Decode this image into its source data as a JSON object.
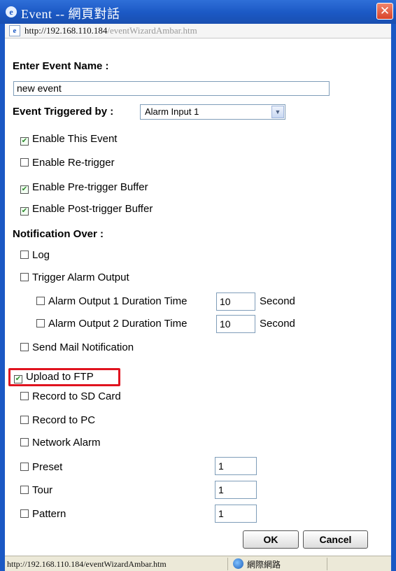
{
  "window": {
    "title": "Event -- 網頁對話",
    "close_glyph": "✕",
    "address": {
      "host": "http://192.168.110.184",
      "path": "/eventWizardAmbar.htm"
    }
  },
  "form": {
    "event_name_label": "Enter Event Name :",
    "event_name_value": "new event",
    "triggered_by_label": "Event Triggered by :",
    "triggered_by_value": "Alarm Input 1",
    "options": [
      {
        "label": "Enable This Event",
        "checked": true
      },
      {
        "label": "Enable Re-trigger",
        "checked": false
      },
      {
        "label": "Enable Pre-trigger Buffer",
        "checked": true
      },
      {
        "label": "Enable Post-trigger Buffer",
        "checked": true
      }
    ],
    "notification_label": "Notification Over :",
    "notifications": {
      "log": {
        "label": "Log",
        "checked": false
      },
      "trigger_alarm_output": {
        "label": "Trigger Alarm Output",
        "checked": false
      },
      "alarm_output_1": {
        "label": "Alarm Output 1 Duration Time",
        "checked": false,
        "value": "10",
        "unit": "Second"
      },
      "alarm_output_2": {
        "label": "Alarm Output 2 Duration Time",
        "checked": false,
        "value": "10",
        "unit": "Second"
      },
      "send_mail": {
        "label": "Send Mail Notification",
        "checked": false
      },
      "upload_ftp": {
        "label": "Upload to FTP",
        "checked": true
      },
      "record_sd": {
        "label": "Record to SD Card",
        "checked": false
      },
      "record_pc": {
        "label": "Record to PC",
        "checked": false
      },
      "network_alarm": {
        "label": "Network Alarm",
        "checked": false
      },
      "preset": {
        "label": "Preset",
        "checked": false,
        "value": "1"
      },
      "tour": {
        "label": "Tour",
        "checked": false,
        "value": "1"
      },
      "pattern": {
        "label": "Pattern",
        "checked": false,
        "value": "1"
      }
    },
    "ok_label": "OK",
    "cancel_label": "Cancel"
  },
  "status": {
    "url": "http://192.168.110.184/eventWizardAmbar.htm",
    "zone": "網際網路"
  },
  "colors": {
    "titlebar": "#1b58c4",
    "highlight": "#e0131f"
  }
}
